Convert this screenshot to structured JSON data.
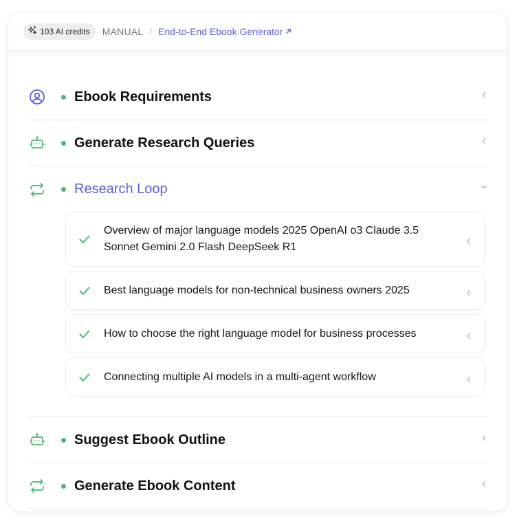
{
  "header": {
    "credits_label": "103 AI credits",
    "mode_label": "MANUAL",
    "separator": "/",
    "workflow_link": "End-to-End Ebook Generator"
  },
  "steps": [
    {
      "title": "Ebook Requirements",
      "icon": "user-circle-icon",
      "status": "done",
      "expanded": false
    },
    {
      "title": "Generate Research Queries",
      "icon": "robot-icon",
      "status": "done",
      "expanded": false
    },
    {
      "title": "Research Loop",
      "icon": "loop-arrows-icon",
      "status": "done",
      "expanded": true,
      "items": [
        "Overview of major language models 2025 OpenAI o3 Claude 3.5 Sonnet Gemini 2.0 Flash DeepSeek R1",
        "Best language models for non-technical business owners 2025",
        "How to choose the right language model for business processes",
        "Connecting multiple AI models in a multi-agent workflow"
      ]
    },
    {
      "title": "Suggest Ebook Outline",
      "icon": "robot-icon",
      "status": "done",
      "expanded": false
    },
    {
      "title": "Generate Ebook Content",
      "icon": "loop-arrows-icon",
      "status": "done",
      "expanded": false
    }
  ],
  "colors": {
    "accent": "#5a5fd6",
    "success": "#4cb873",
    "muted": "#777777"
  }
}
